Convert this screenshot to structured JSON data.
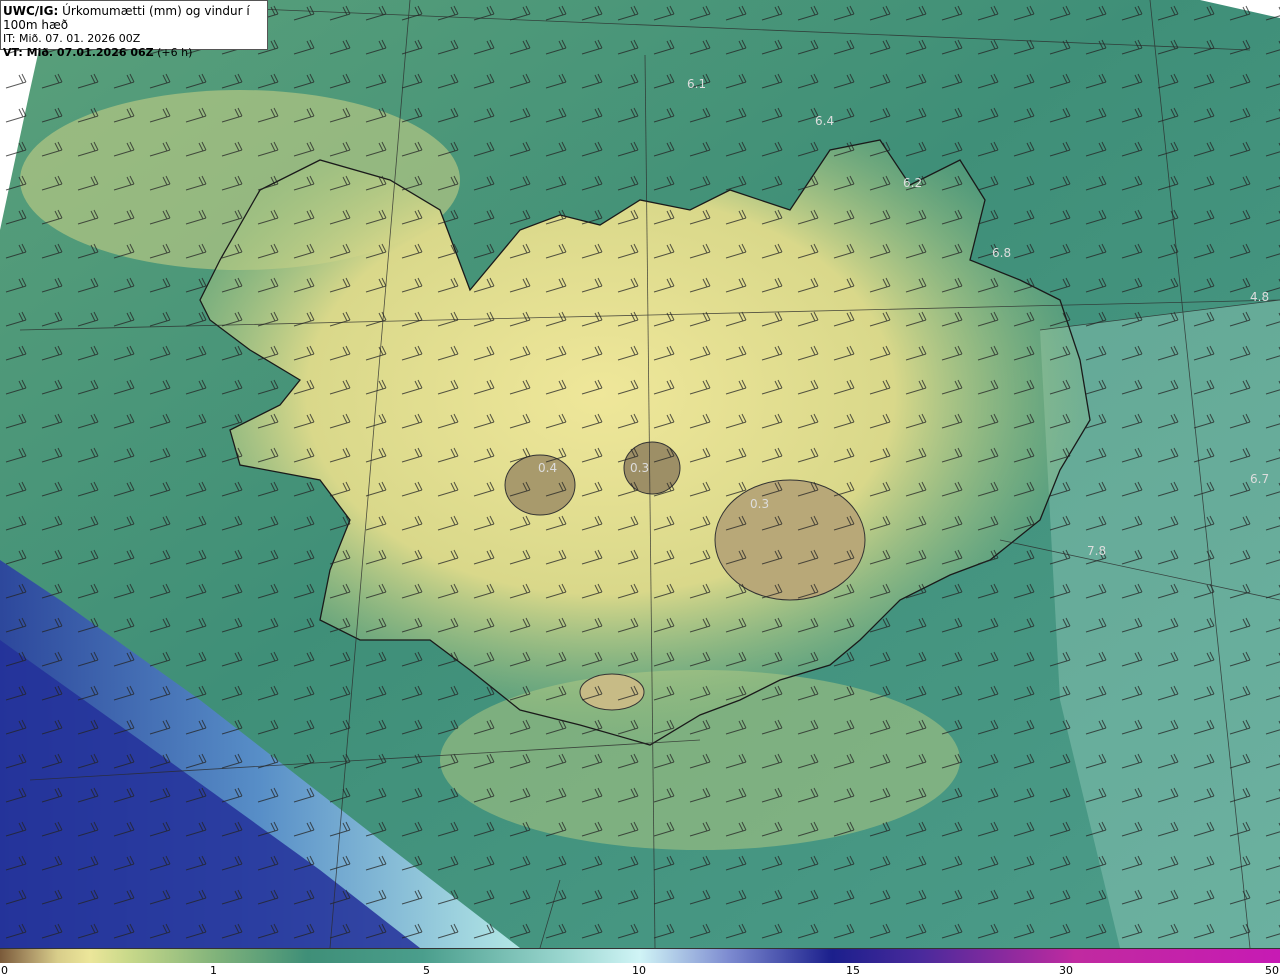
{
  "title": {
    "prefix": "UWC/IG:",
    "text": "Úrkomumætti (mm) og vindur í 100m hæð",
    "it": "IT: Mið. 07. 01. 2026 00Z",
    "vt_prefix": "VT: Mið. 07.01.2026 06Z",
    "vt_suffix": "(+6 h)"
  },
  "map_labels": [
    {
      "text": "6.1"
    },
    {
      "text": "6.4"
    },
    {
      "text": "6.2"
    },
    {
      "text": "6.8"
    },
    {
      "text": "4.8"
    },
    {
      "text": "0.4"
    },
    {
      "text": "0.3"
    },
    {
      "text": "0.3"
    },
    {
      "text": "6.7"
    },
    {
      "text": "7.8"
    }
  ],
  "colorbar": {
    "ticks": [
      "0",
      "1",
      "5",
      "10",
      "15",
      "30",
      "50"
    ]
  },
  "colors": {
    "land": "#e6df90",
    "sea": "#3f8f78",
    "heavy": "#1b1f8c",
    "coast": "#1a1a1a"
  }
}
